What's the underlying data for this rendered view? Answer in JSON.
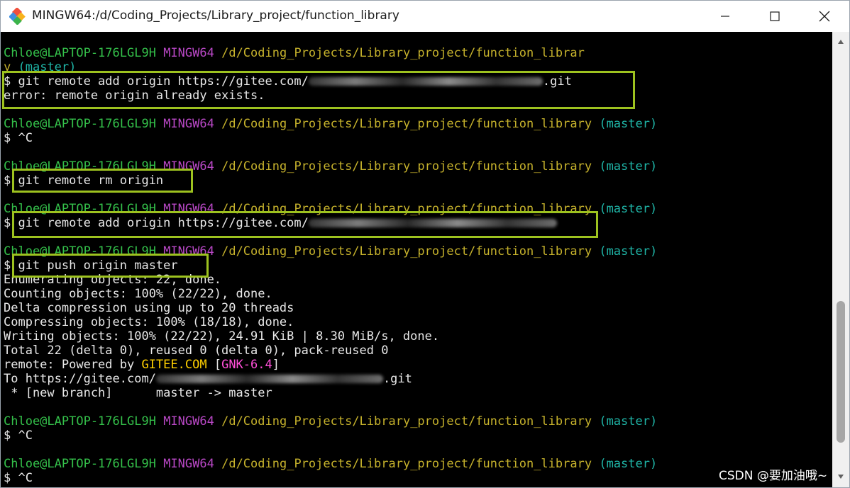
{
  "window": {
    "title": "MINGW64:/d/Coding_Projects/Library_project/function_library"
  },
  "prompt": {
    "user": "Chloe@LAPTOP-176LGL9H",
    "host": "MINGW64",
    "path": "/d/Coding_Projects/Library_project/function_library",
    "path_wrapped_first": "/d/Coding_Projects/Library_project/function_librar",
    "path_wrapped_rest": "y",
    "branch": "(master)"
  },
  "commands": {
    "remote_add_prefix": "$ git remote add origin https://gitee.com/",
    "remote_add_suffix": ".git",
    "error": "error: remote origin already exists.",
    "ctrl_c": "$ ^C",
    "remote_rm": "$ git remote rm origin",
    "push": "$ git push origin master"
  },
  "push_output": {
    "enumerating": "Enumerating objects: 22, done.",
    "counting": "Counting objects: 100% (22/22), done.",
    "delta": "Delta compression using up to 20 threads",
    "compressing": "Compressing objects: 100% (18/18), done.",
    "writing": "Writing objects: 100% (22/22), 24.91 KiB | 8.30 MiB/s, done.",
    "total": "Total 22 (delta 0), reused 0 (delta 0), pack-reused 0",
    "remote_prefix": "remote: Powered by ",
    "gitee": "GITEE.COM",
    "gnk_open": " [",
    "gnk": "GNK-6.4",
    "gnk_close": "]",
    "to_prefix": "To https://gitee.com/",
    "to_suffix": ".git",
    "new_branch": " * [new branch]      master -> master"
  },
  "watermark": "CSDN @要加油哦~",
  "colors": {
    "user": "#34c04a",
    "host": "#b948c6",
    "path": "#c6b22c",
    "branch": "#1fb5a7",
    "highlight": "#9dc21f"
  }
}
